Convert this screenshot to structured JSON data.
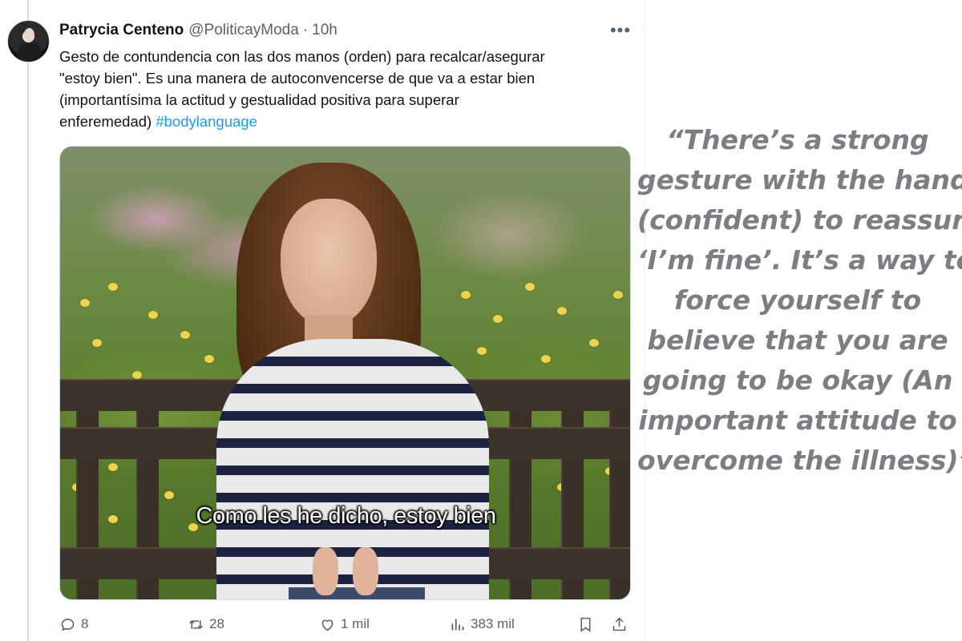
{
  "tweet": {
    "author": {
      "display_name": "Patrycia Centeno",
      "handle": "@PoliticayModa",
      "separator": "·",
      "time": "10h"
    },
    "more_icon": "more-horizontal-icon",
    "text_lines": [
      "Gesto de contundencia con las dos manos (orden) para recalcar/asegurar",
      "\"estoy bien\". Es una manera de autoconvencerse de que va a estar bien",
      "(importantísima la actitud y gestualidad positiva para superar",
      "enferemedad)"
    ],
    "hashtag": "#bodylanguage",
    "media": {
      "subtitle": "Como les he dicho, estoy bien"
    },
    "actions": {
      "replies": "8",
      "retweets": "28",
      "likes": "1 mil",
      "views": "383 mil"
    },
    "action_icons": [
      "reply-icon",
      "retweet-icon",
      "like-icon",
      "views-icon",
      "bookmark-icon",
      "share-icon"
    ],
    "colors": {
      "hashtag": "#1d9bf0",
      "secondary_text": "#536471",
      "primary_text": "#0f1419"
    }
  },
  "quote": {
    "lines": [
      "“There’s a strong",
      "gesture with the hands",
      "(confident) to reassure",
      "‘I’m fine’. It’s a way to",
      "force yourself to",
      "believe that you are",
      "going to be okay (An",
      "important attitude to",
      "overcome the illness)”"
    ],
    "color": "#7d7d84"
  }
}
